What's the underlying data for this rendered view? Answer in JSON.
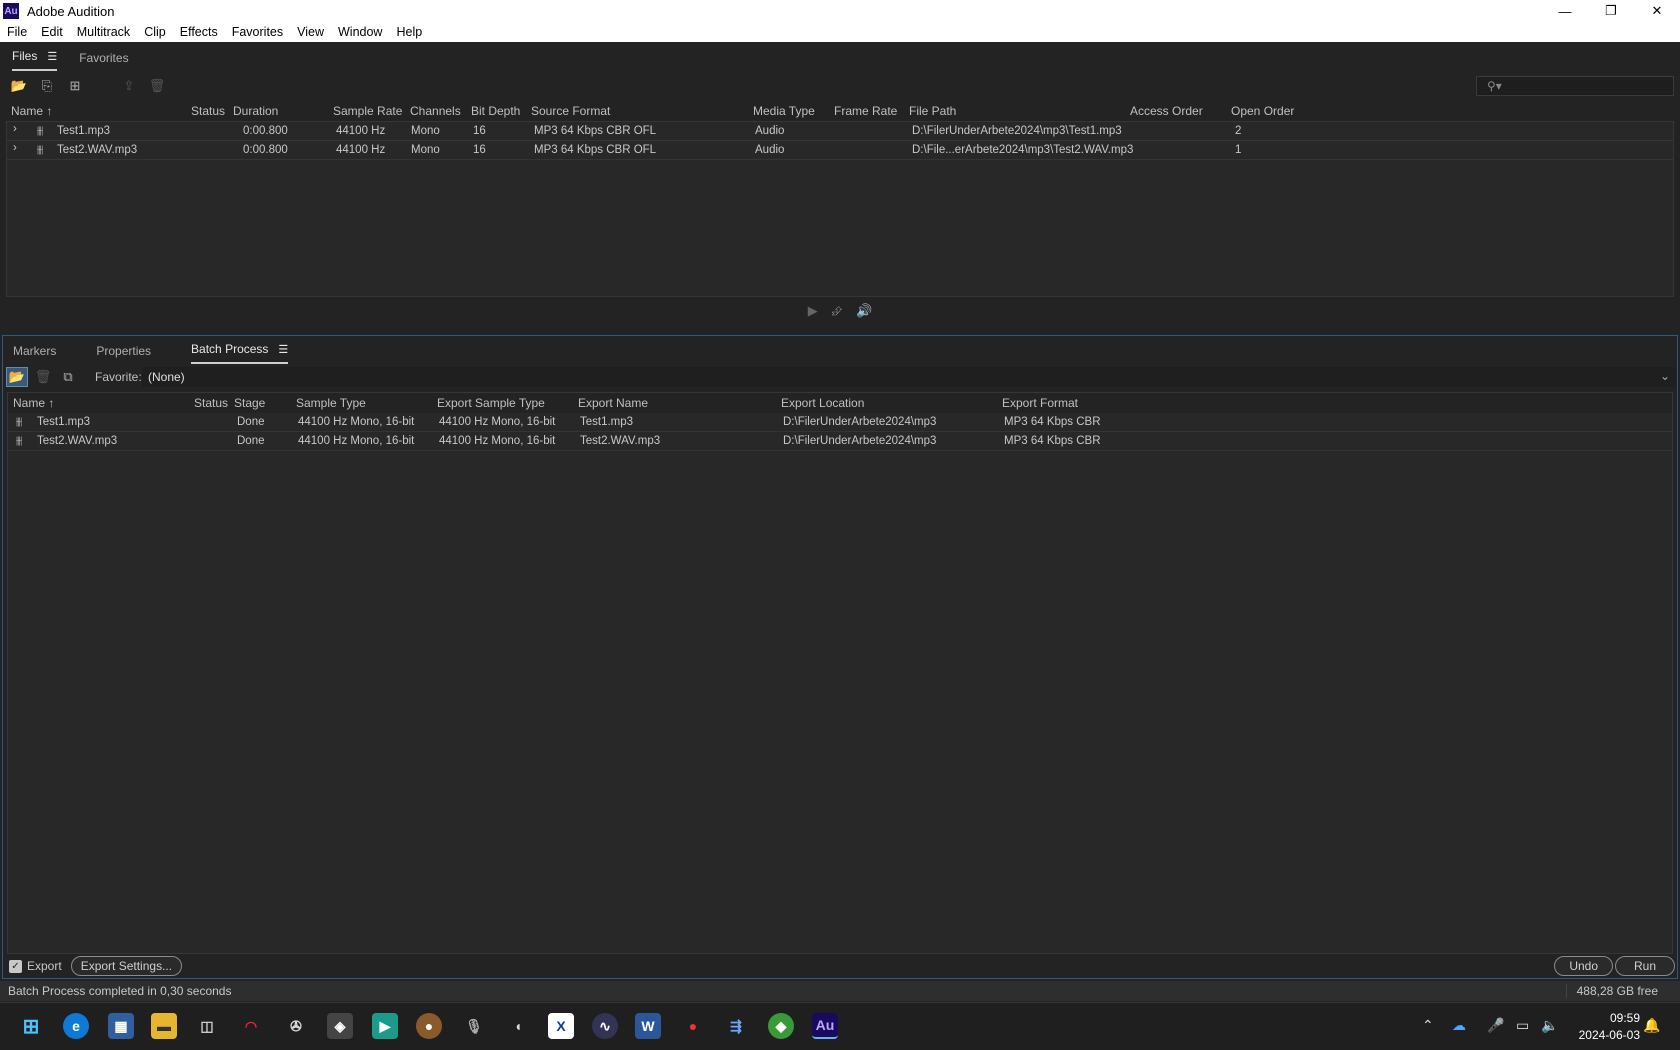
{
  "window": {
    "title": "Adobe Audition",
    "app_icon": "Au"
  },
  "menu": [
    "File",
    "Edit",
    "Multitrack",
    "Clip",
    "Effects",
    "Favorites",
    "View",
    "Window",
    "Help"
  ],
  "files_panel": {
    "tabs": [
      {
        "label": "Files",
        "active": true
      },
      {
        "label": "Favorites",
        "active": false
      }
    ],
    "search_placeholder": "",
    "columns": [
      "Name",
      "Status",
      "Duration",
      "Sample Rate",
      "Channels",
      "Bit Depth",
      "Source Format",
      "Media Type",
      "Frame Rate",
      "File Path",
      "Access Order",
      "Open Order"
    ],
    "rows": [
      {
        "name": "Test1.mp3",
        "status": "",
        "duration": "0:00.800",
        "sample_rate": "44100 Hz",
        "channels": "Mono",
        "bit_depth": "16",
        "source_format": "MP3 64 Kbps CBR OFL",
        "media_type": "Audio",
        "frame_rate": "",
        "file_path": "D:\\FilerUnderArbete2024\\mp3\\Test1.mp3",
        "access_order": "",
        "open_order": "2"
      },
      {
        "name": "Test2.WAV.mp3",
        "status": "",
        "duration": "0:00.800",
        "sample_rate": "44100 Hz",
        "channels": "Mono",
        "bit_depth": "16",
        "source_format": "MP3 64 Kbps CBR OFL",
        "media_type": "Audio",
        "frame_rate": "",
        "file_path": "D:\\File...erArbete2024\\mp3\\Test2.WAV.mp3",
        "access_order": "",
        "open_order": "1"
      }
    ]
  },
  "batch_panel": {
    "tabs": [
      {
        "label": "Markers",
        "active": false
      },
      {
        "label": "Properties",
        "active": false
      },
      {
        "label": "Batch Process",
        "active": true
      }
    ],
    "favorite_label": "Favorite:",
    "favorite_value": "(None)",
    "columns": [
      "Name",
      "Status",
      "Stage",
      "Sample Type",
      "Export Sample Type",
      "Export Name",
      "Export Location",
      "Export Format"
    ],
    "rows": [
      {
        "name": "Test1.mp3",
        "status": "",
        "stage": "Done",
        "sample_type": "44100 Hz Mono, 16-bit",
        "export_sample_type": "44100 Hz Mono, 16-bit",
        "export_name": "Test1.mp3",
        "export_location": "D:\\FilerUnderArbete2024\\mp3",
        "export_format": "MP3 64 Kbps CBR"
      },
      {
        "name": "Test2.WAV.mp3",
        "status": "",
        "stage": "Done",
        "sample_type": "44100 Hz Mono, 16-bit",
        "export_sample_type": "44100 Hz Mono, 16-bit",
        "export_name": "Test2.WAV.mp3",
        "export_location": "D:\\FilerUnderArbete2024\\mp3",
        "export_format": "MP3 64 Kbps CBR"
      }
    ],
    "export_label": "Export",
    "export_checked": true,
    "export_settings_label": "Export Settings...",
    "undo_label": "Undo",
    "run_label": "Run"
  },
  "status": {
    "message": "Batch Process completed in 0,30 seconds",
    "free_space": "488,28 GB free"
  },
  "taskbar": {
    "time": "09:59",
    "date": "2024-06-03"
  },
  "colors": {
    "accent_blue": "#2a5a8a",
    "audition_icon_bg": "#1a0a5e",
    "panel_bg": "#232323"
  }
}
